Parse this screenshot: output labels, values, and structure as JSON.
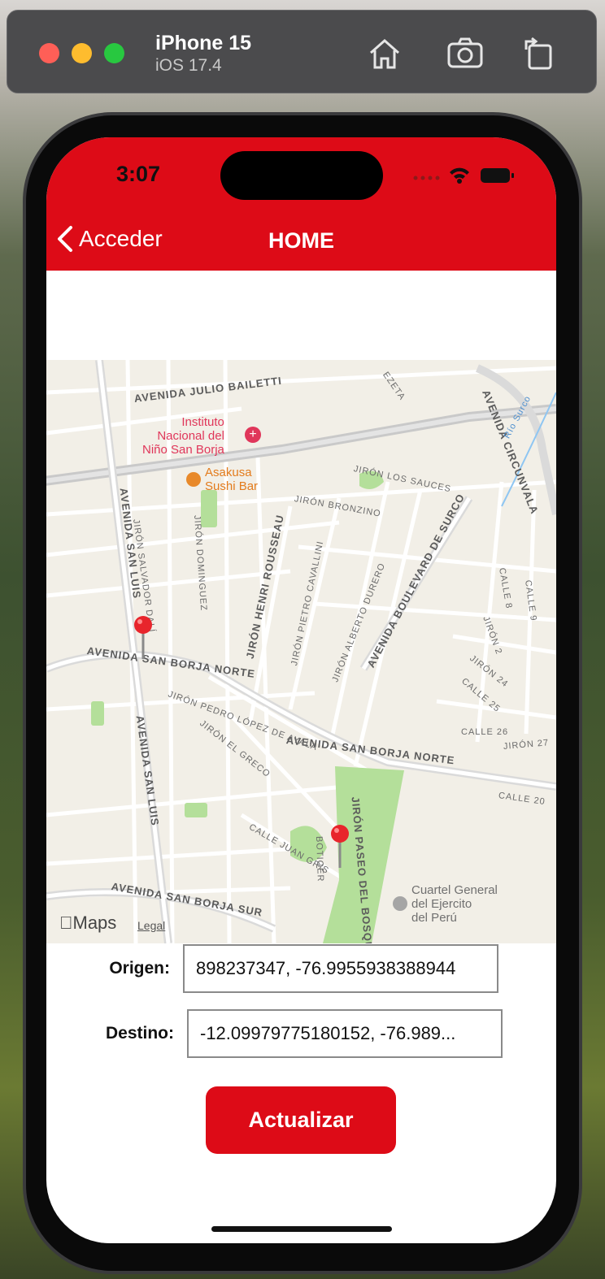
{
  "simulator": {
    "device_name": "iPhone 15",
    "os_version": "iOS 17.4",
    "buttons": [
      "home-icon",
      "screenshot-icon",
      "rotate-icon"
    ]
  },
  "status_bar": {
    "time": "3:07"
  },
  "nav": {
    "back_label": "Acceder",
    "title": "HOME"
  },
  "map": {
    "streets": [
      "AVENIDA JULIO BAILETTI",
      "AVENIDA SAN LUIS",
      "AVENIDA SAN BORJA NORTE",
      "AVENIDA SAN BORJA SUR",
      "AVENIDA BOULEVARD DE SURCO",
      "AVENIDA CIRCUNVALA",
      "JIRÓN SALVADOR DALÍ",
      "JIRÓN DOMINGUEZ",
      "JIRÓN HENRI ROUSSEAU",
      "JIRÓN PIETRO CAVALLINI",
      "JIRÓN ALBERTO DURERO",
      "JIRÓN BRONZINO",
      "JIRÓN LOS SAUCES",
      "JIRÓN PEDRO LÓPEZ DE AYALA",
      "JIRÓN EL GRECO",
      "JIRÓN PASEO DEL BOSQU",
      "CALLE JUAN GRIS",
      "BOTIGER",
      "CALLE 26",
      "JIRÓN 27",
      "CALLE 20",
      "CALLE 25",
      "JIRÓN 24",
      "JIRÓN 2",
      "CALLE 8",
      "CALLE 9",
      "EZETA",
      "Río Surco",
      "JIRÓN SALVADOR DALÍ"
    ],
    "poi_hospital": [
      "Instituto",
      "Nacional del",
      "Niño San Borja"
    ],
    "poi_sushi": [
      "Asakusa",
      "Sushi Bar"
    ],
    "poi_army": [
      "Cuartel General",
      "del Ejercito",
      "del Perú"
    ],
    "brand": "Maps",
    "legal": "Legal"
  },
  "form": {
    "origin_label": "Origen:",
    "origin_value": "898237347, -76.9955938388944",
    "destination_label": "Destino:",
    "destination_value": "-12.09979775180152, -76.989..."
  },
  "button": {
    "update_label": "Actualizar"
  },
  "colors": {
    "brand_red": "#dd0b17"
  }
}
